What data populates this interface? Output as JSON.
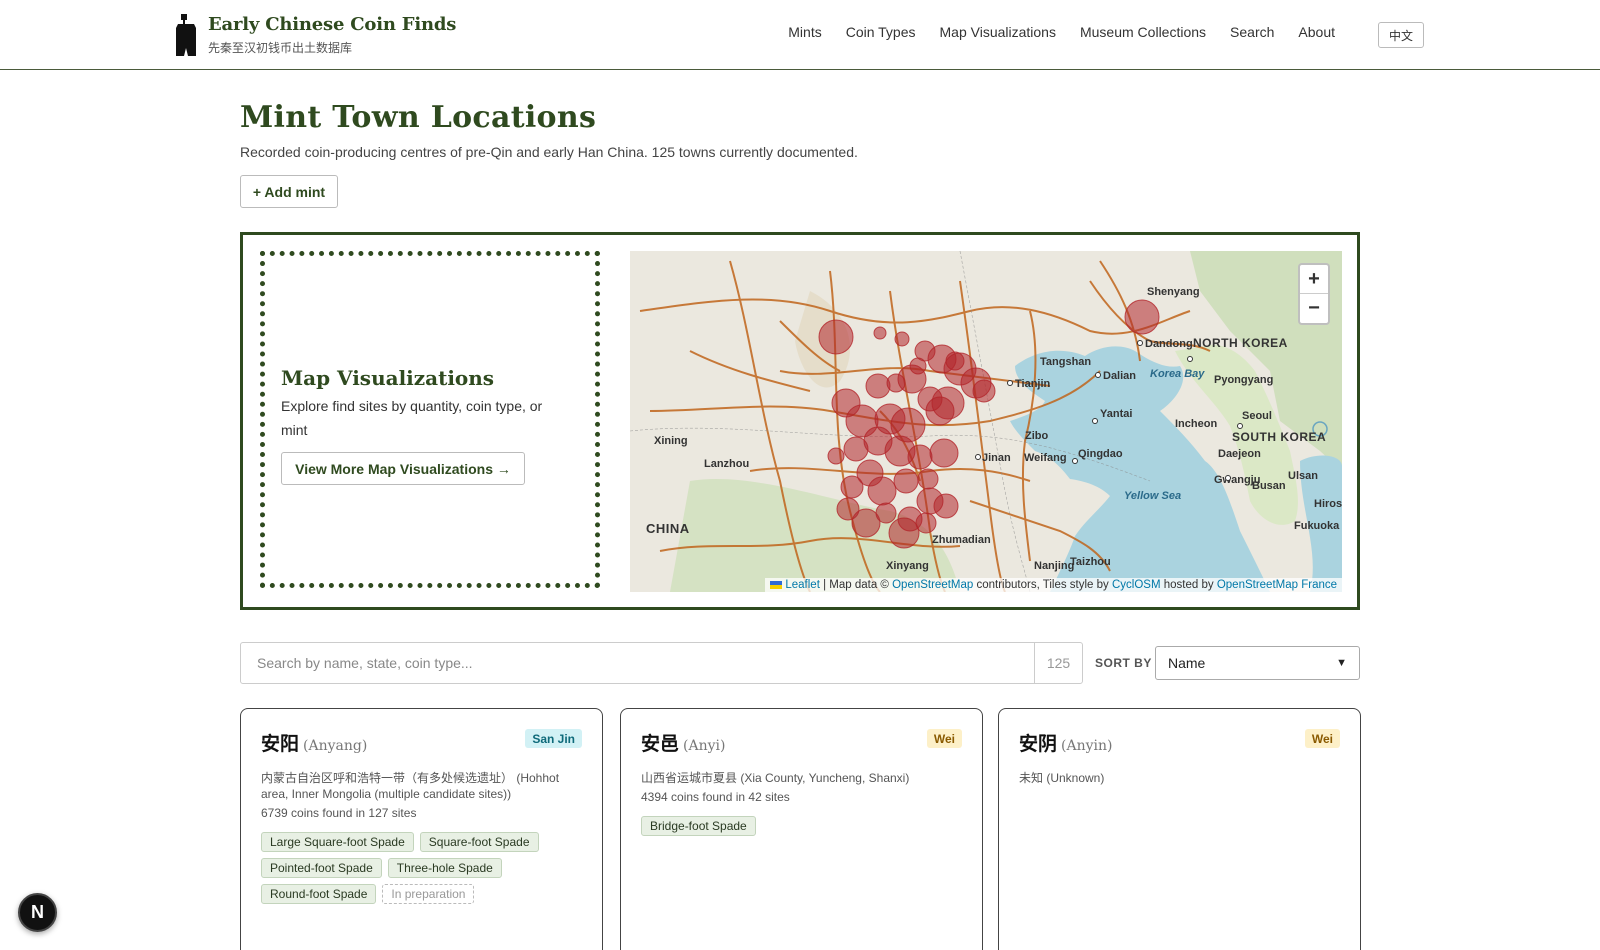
{
  "header": {
    "title": "Early Chinese Coin Finds",
    "subtitle": "先秦至汉初钱币出土数据库",
    "nav": [
      "Mints",
      "Coin Types",
      "Map Visualizations",
      "Museum Collections",
      "Search",
      "About"
    ],
    "lang_button": "中文"
  },
  "page": {
    "title": "Mint Town Locations",
    "description": "Recorded coin-producing centres of pre-Qin and early Han China. 125 towns currently documented.",
    "add_button": "+ Add mint"
  },
  "map_panel": {
    "title": "Map Visualizations",
    "description": "Explore find sites by quantity, coin type, or mint",
    "button": "View More Map Visualizations →",
    "zoom_in": "+",
    "zoom_out": "−",
    "attribution": {
      "leaflet": "Leaflet",
      "sep1": " | Map data © ",
      "osm": "OpenStreetMap",
      "mid": " contributors, Tiles style by ",
      "cyclosm": "CyclOSM",
      "hosted": " hosted by ",
      "osmfr": "OpenStreetMap France"
    },
    "labels": {
      "shenyang": "Shenyang",
      "dandong": "Dandong",
      "north_korea": "NORTH KOREA",
      "pyongyang": "Pyongyang",
      "korea_bay": "Korea Bay",
      "dalian": "Dalian",
      "yantai": "Yantai",
      "incheon": "Incheon",
      "seoul": "Seoul",
      "south_korea": "SOUTH KOREA",
      "daejeon": "Daejeon",
      "gwangju": "Gwangju",
      "busan": "Busan",
      "ulsan": "Ulsan",
      "yellow_sea": "Yellow Sea",
      "qingdao": "Qingdao",
      "weifang": "Weifang",
      "zibo": "Zibo",
      "jinan": "Jinan",
      "tianjin": "Tianjin",
      "tangshan": "Tangshan",
      "xining": "Xining",
      "lanzhou": "Lanzhou",
      "china": "CHINA",
      "zhumadian": "Zhumadian",
      "nanjing": "Nanjing",
      "taizhou": "Taizhou",
      "hiroshima": "Hiroshima",
      "fukuoka": "Fukuoka",
      "xinyang": "Xinyang"
    }
  },
  "search": {
    "placeholder": "Search by name, state, coin type...",
    "count": "125",
    "sort_label": "SORT BY",
    "sort_value": "Name"
  },
  "mints": [
    {
      "name": "安阳",
      "roman": "(Anyang)",
      "state": "San Jin",
      "location": "内蒙古自治区呼和浩特一带（有多处候选遗址） (Hohhot area, Inner Mongolia (multiple candidate sites))",
      "count": "6739 coins found in 127 sites",
      "tags": [
        "Large Square-foot Spade",
        "Square-foot Spade",
        "Pointed-foot Spade",
        "Three-hole Spade",
        "Round-foot Spade"
      ],
      "prep": "In preparation"
    },
    {
      "name": "安邑",
      "roman": "(Anyi)",
      "state": "Wei",
      "location": "山西省运城市夏县 (Xia County, Yuncheng, Shanxi)",
      "count": "4394 coins found in 42 sites",
      "tags": [
        "Bridge-foot Spade"
      ]
    },
    {
      "name": "安阴",
      "roman": "(Anyin)",
      "state": "Wei",
      "location": "未知 (Unknown)"
    }
  ],
  "floating_button": "N",
  "colors": {
    "accent": "#2f4a1f",
    "marker": "#b3262b",
    "sea": "#a9d3e8",
    "road": "#c0651c"
  }
}
